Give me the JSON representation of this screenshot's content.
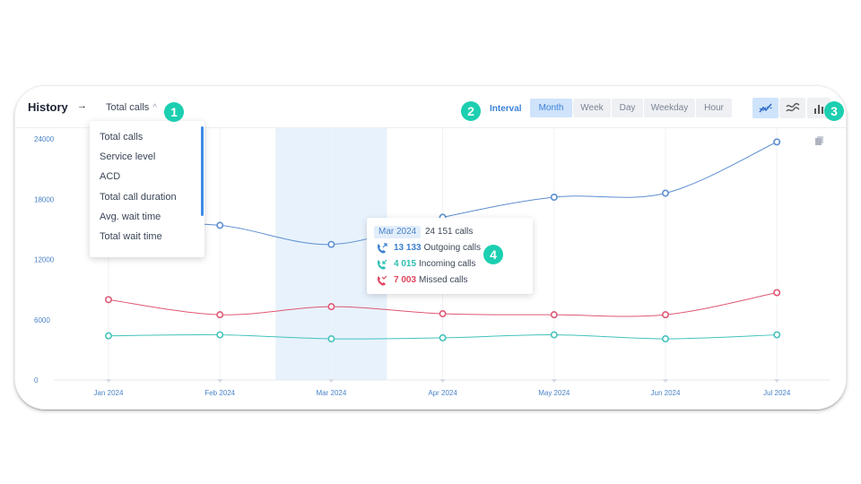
{
  "header": {
    "title": "History",
    "arrow": "→",
    "metric_selected": "Total calls",
    "interval_label": "Interval",
    "intervals": [
      {
        "label": "Month",
        "active": true
      },
      {
        "label": "Week",
        "active": false
      },
      {
        "label": "Day",
        "active": false
      },
      {
        "label": "Weekday",
        "active": false
      },
      {
        "label": "Hour",
        "active": false
      }
    ],
    "views": [
      {
        "icon": "line-chart-icon",
        "active": true
      },
      {
        "icon": "smooth-line-icon",
        "active": false
      },
      {
        "icon": "bar-chart-icon",
        "active": false
      }
    ]
  },
  "badges": [
    "1",
    "2",
    "3",
    "4"
  ],
  "dropdown": {
    "items": [
      "Total calls",
      "Service level",
      "ACD",
      "Total call duration",
      "Avg. wait time",
      "Total wait time"
    ]
  },
  "tooltip": {
    "date": "Mar 2024",
    "total": "24 151 calls",
    "rows": [
      {
        "value": "13 133",
        "label": "Outgoing calls",
        "color": "#3a7fd0",
        "icon": "outgoing-call-icon"
      },
      {
        "value": "4 015",
        "label": "Incoming calls",
        "color": "#2cbfb2",
        "icon": "incoming-call-icon"
      },
      {
        "value": "7 003",
        "label": "Missed calls",
        "color": "#e0455f",
        "icon": "missed-call-icon"
      }
    ]
  },
  "chart_data": {
    "type": "line",
    "categories": [
      "Jan 2024",
      "Feb 2024",
      "Mar 2024",
      "Apr 2024",
      "May 2024",
      "Jun 2024",
      "Jul 2024"
    ],
    "yticks": [
      "0",
      "6000",
      "12000",
      "18000",
      "24000"
    ],
    "ylim": [
      0,
      24000
    ],
    "highlight_category": "Mar 2024",
    "series": [
      {
        "name": "Outgoing calls",
        "color": "#5d8fd1",
        "values": [
          15600,
          15400,
          13500,
          16200,
          18200,
          18600,
          23700
        ]
      },
      {
        "name": "Incoming calls",
        "color": "#43c2bb",
        "values": [
          4400,
          4500,
          4100,
          4200,
          4500,
          4100,
          4500
        ]
      },
      {
        "name": "Missed calls",
        "color": "#df5874",
        "values": [
          8000,
          6500,
          7300,
          6600,
          6500,
          6500,
          8700
        ]
      }
    ]
  }
}
